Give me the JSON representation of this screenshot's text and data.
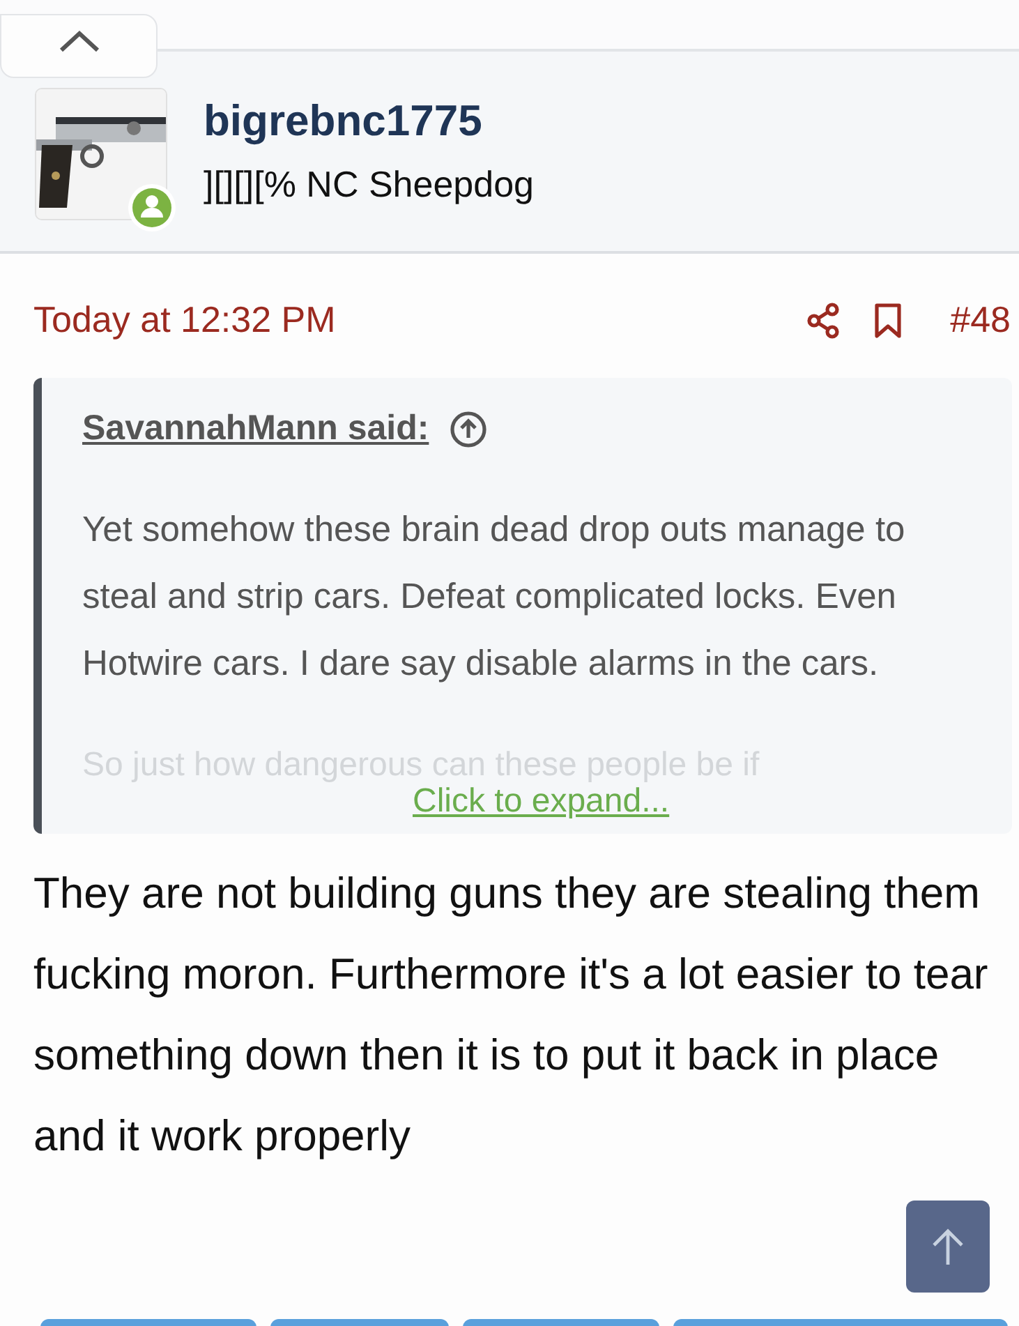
{
  "author": {
    "username": "bigrebnc1775",
    "user_title": "][][][% NC Sheepdog",
    "online": true
  },
  "post_meta": {
    "time": "Today at 12:32 PM",
    "post_number": "#48"
  },
  "quote": {
    "author_line": "SavannahMann said:",
    "lines": [
      "Yet somehow these brain dead drop outs manage to steal and strip cars. Defeat complicated locks. Even Hotwire cars. I dare say disable alarms in the cars."
    ],
    "faded_line": "So just how dangerous can these people be if",
    "expand_link": "Click to expand..."
  },
  "body": "They are not building guns they are stealing them fucking moron. Furthermore it's a lot easier to tear something down then it is to put it back in place and it work properly"
}
